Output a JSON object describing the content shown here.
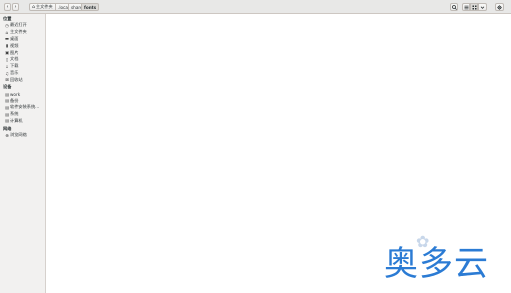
{
  "toolbar": {
    "back_icon": "‹",
    "forward_icon": "›",
    "search_icon": "search-icon",
    "list_view_icon": "list-view-icon",
    "grid_view_icon": "grid-view-icon",
    "menu_icon": "chevron-down-icon",
    "settings_icon": "gear-icon"
  },
  "breadcrumb": {
    "home_label": "主文件夹",
    "parts": [
      ".local",
      "share",
      "fonts"
    ]
  },
  "sidebar": {
    "sections": [
      {
        "title": "位置",
        "items": [
          {
            "icon": "◷",
            "label": "最近打开"
          },
          {
            "icon": "⌂",
            "label": "主文件夹"
          },
          {
            "icon": "▬",
            "label": "桌面"
          },
          {
            "icon": "▮",
            "label": "视频"
          },
          {
            "icon": "▣",
            "label": "图片"
          },
          {
            "icon": "▯",
            "label": "文档"
          },
          {
            "icon": "↓",
            "label": "下载"
          },
          {
            "icon": "♫",
            "label": "音乐"
          },
          {
            "icon": "⊠",
            "label": "回收站"
          }
        ]
      },
      {
        "title": "设备",
        "items": [
          {
            "icon": "▤",
            "label": "work"
          },
          {
            "icon": "▤",
            "label": "备份"
          },
          {
            "icon": "▤",
            "label": "软件安装系统..."
          },
          {
            "icon": "▤",
            "label": "系统"
          },
          {
            "icon": "▤",
            "label": "计算机"
          }
        ]
      },
      {
        "title": "网络",
        "items": [
          {
            "icon": "⊕",
            "label": "浏览网络"
          }
        ]
      }
    ]
  },
  "watermark": {
    "text": "奥多云"
  }
}
